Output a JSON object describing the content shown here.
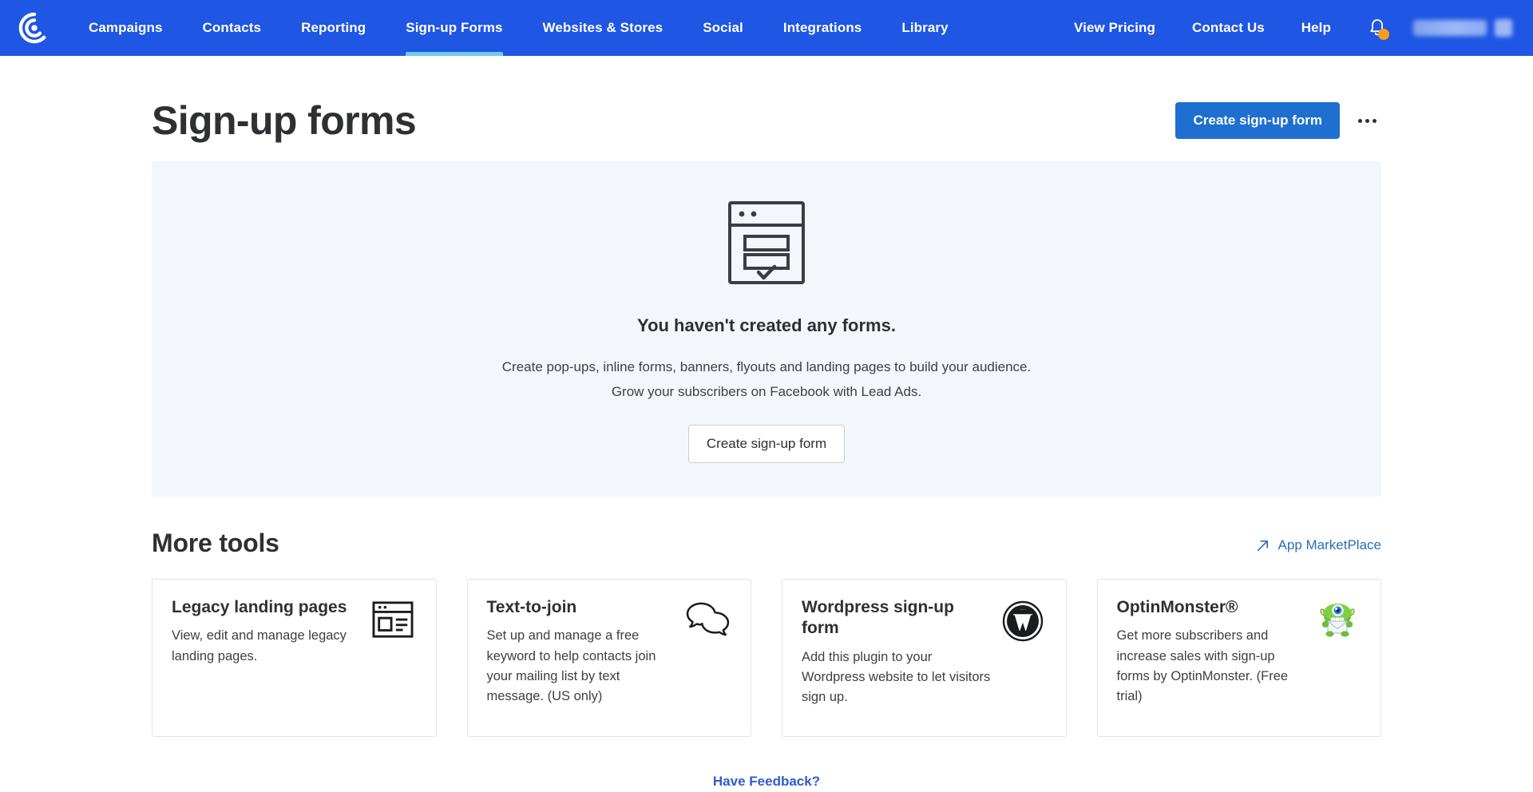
{
  "brand": {
    "accent_blue": "#1f56e3",
    "active_underline": "#6fcbe8",
    "button_blue": "#1f6fd0",
    "link_blue": "#2b6cb8",
    "notification_orange": "#f8a01b",
    "panel_bg": "#f3f6fa",
    "logo_name": "constant-contact-logo"
  },
  "topnav": {
    "left_items": [
      {
        "label": "Campaigns",
        "active": false
      },
      {
        "label": "Contacts",
        "active": false
      },
      {
        "label": "Reporting",
        "active": false
      },
      {
        "label": "Sign-up Forms",
        "active": true
      },
      {
        "label": "Websites & Stores",
        "active": false
      },
      {
        "label": "Social",
        "active": false
      },
      {
        "label": "Integrations",
        "active": false
      },
      {
        "label": "Library",
        "active": false
      }
    ],
    "right_items": [
      {
        "label": "View Pricing"
      },
      {
        "label": "Contact Us"
      },
      {
        "label": "Help"
      }
    ],
    "bell_icon": "notification-bell-icon",
    "bell_has_badge": true,
    "account_name_redacted": ""
  },
  "header": {
    "title": "Sign-up forms",
    "create_button": "Create sign-up form",
    "more_menu_icon": "kebab-menu-icon"
  },
  "empty_state": {
    "illustration": "signup-form-window-icon",
    "title": "You haven't created any forms.",
    "line1": "Create pop-ups, inline forms, banners, flyouts and landing pages to build your audience.",
    "line2": "Grow your subscribers on Facebook with Lead Ads.",
    "button": "Create sign-up form"
  },
  "more_tools": {
    "title": "More tools",
    "marketplace_link": "App MarketPlace",
    "marketplace_icon": "external-link-arrow-icon",
    "cards": [
      {
        "title": "Legacy landing pages",
        "desc": "View, edit and manage legacy landing pages.",
        "icon": "landing-page-layout-icon"
      },
      {
        "title": "Text-to-join",
        "desc": "Set up and manage a free keyword to help contacts join your mailing list by text message. (US only)",
        "icon": "speech-bubbles-icon"
      },
      {
        "title": "Wordpress sign-up form",
        "desc": "Add this plugin to your Wordpress website to let visitors sign up.",
        "icon": "wordpress-logo-icon"
      },
      {
        "title": "OptinMonster®",
        "desc": "Get more subscribers and increase sales with sign-up forms by OptinMonster. (Free trial)",
        "icon": "optinmonster-mascot-icon"
      }
    ]
  },
  "footer": {
    "feedback_link": "Have Feedback?"
  }
}
